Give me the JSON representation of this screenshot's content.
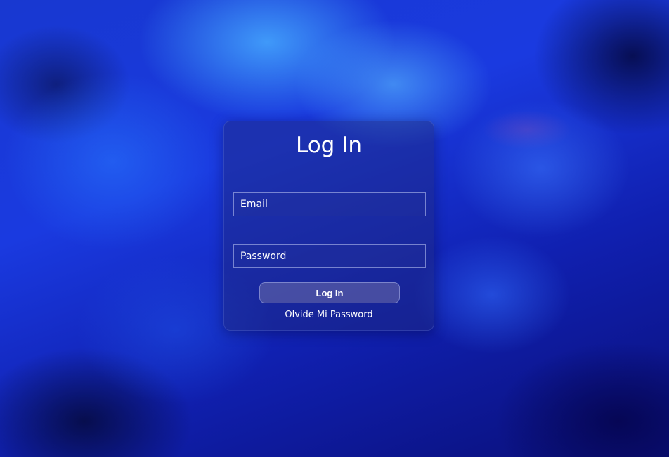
{
  "login": {
    "title": "Log In",
    "email_placeholder": "Email",
    "password_placeholder": "Password",
    "submit_label": "Log In",
    "forgot_link": "Olvide Mi Password"
  },
  "colors": {
    "background_primary": "#1a3ae0",
    "background_dark": "#0a0f78",
    "text": "#ffffff"
  }
}
